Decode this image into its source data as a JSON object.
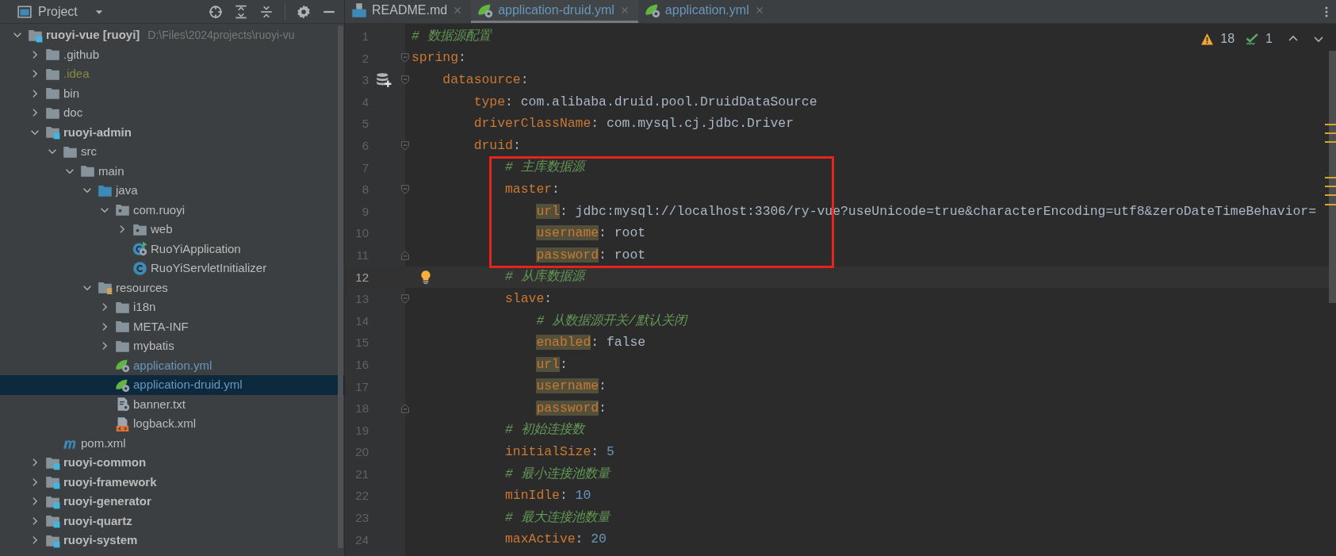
{
  "project_panel": {
    "title": "Project",
    "tree": [
      {
        "label": "ruoyi-vue [ruoyi]",
        "location": "D:\\Files\\2024projects\\ruoyi-vu",
        "kind": "module",
        "expanded": true,
        "selected": false,
        "ignored": false,
        "modified": false,
        "children": [
          {
            "label": ".github",
            "kind": "folder",
            "expanded": false,
            "selected": false,
            "ignored": false,
            "modified": false
          },
          {
            "label": ".idea",
            "kind": "folder",
            "expanded": false,
            "selected": false,
            "ignored": true,
            "modified": false
          },
          {
            "label": "bin",
            "kind": "folder",
            "expanded": false,
            "selected": false,
            "ignored": false,
            "modified": false
          },
          {
            "label": "doc",
            "kind": "folder",
            "expanded": false,
            "selected": false,
            "ignored": false,
            "modified": false
          },
          {
            "label": "ruoyi-admin",
            "kind": "module",
            "expanded": true,
            "selected": false,
            "ignored": false,
            "modified": false,
            "children": [
              {
                "label": "src",
                "kind": "folder",
                "expanded": true,
                "selected": false,
                "ignored": false,
                "modified": false,
                "children": [
                  {
                    "label": "main",
                    "kind": "folder",
                    "expanded": true,
                    "selected": false,
                    "ignored": false,
                    "modified": false,
                    "children": [
                      {
                        "label": "java",
                        "kind": "source-root",
                        "expanded": true,
                        "selected": false,
                        "ignored": false,
                        "modified": false,
                        "children": [
                          {
                            "label": "com.ruoyi",
                            "kind": "package",
                            "expanded": true,
                            "selected": false,
                            "ignored": false,
                            "modified": false,
                            "children": [
                              {
                                "label": "web",
                                "kind": "package",
                                "expanded": false,
                                "selected": false,
                                "ignored": false,
                                "modified": false
                              },
                              {
                                "label": "RuoYiApplication",
                                "kind": "class-run",
                                "selected": false,
                                "ignored": false,
                                "modified": false
                              },
                              {
                                "label": "RuoYiServletInitializer",
                                "kind": "class",
                                "selected": false,
                                "ignored": false,
                                "modified": false
                              }
                            ]
                          }
                        ]
                      },
                      {
                        "label": "resources",
                        "kind": "resources-root",
                        "expanded": true,
                        "selected": false,
                        "ignored": false,
                        "modified": false,
                        "children": [
                          {
                            "label": "i18n",
                            "kind": "folder",
                            "expanded": false,
                            "selected": false,
                            "ignored": false,
                            "modified": false
                          },
                          {
                            "label": "META-INF",
                            "kind": "folder",
                            "expanded": false,
                            "selected": false,
                            "ignored": false,
                            "modified": false
                          },
                          {
                            "label": "mybatis",
                            "kind": "folder",
                            "expanded": false,
                            "selected": false,
                            "ignored": false,
                            "modified": false
                          },
                          {
                            "label": "application.yml",
                            "kind": "spring-config",
                            "selected": false,
                            "ignored": false,
                            "modified": true
                          },
                          {
                            "label": "application-druid.yml",
                            "kind": "spring-config",
                            "selected": true,
                            "ignored": false,
                            "modified": true
                          },
                          {
                            "label": "banner.txt",
                            "kind": "text",
                            "selected": false,
                            "ignored": false,
                            "modified": false
                          },
                          {
                            "label": "logback.xml",
                            "kind": "xml",
                            "selected": false,
                            "ignored": false,
                            "modified": false
                          }
                        ]
                      }
                    ]
                  }
                ]
              },
              {
                "label": "pom.xml",
                "kind": "maven",
                "selected": false,
                "ignored": false,
                "modified": false
              }
            ]
          },
          {
            "label": "ruoyi-common",
            "kind": "module",
            "expanded": false,
            "selected": false,
            "ignored": false,
            "modified": false
          },
          {
            "label": "ruoyi-framework",
            "kind": "module",
            "expanded": false,
            "selected": false,
            "ignored": false,
            "modified": false
          },
          {
            "label": "ruoyi-generator",
            "kind": "module",
            "expanded": false,
            "selected": false,
            "ignored": false,
            "modified": false
          },
          {
            "label": "ruoyi-quartz",
            "kind": "module",
            "expanded": false,
            "selected": false,
            "ignored": false,
            "modified": false
          },
          {
            "label": "ruoyi-system",
            "kind": "module",
            "expanded": false,
            "selected": false,
            "ignored": false,
            "modified": false
          }
        ]
      }
    ]
  },
  "editor": {
    "tabs": [
      {
        "label": "README.md",
        "kind": "markdown",
        "selected": false,
        "modified": false
      },
      {
        "label": "application-druid.yml",
        "kind": "spring-config",
        "selected": true,
        "modified": true
      },
      {
        "label": "application.yml",
        "kind": "spring-config",
        "selected": false,
        "modified": true
      }
    ],
    "inspections": {
      "warnings": "18",
      "passed": "1"
    },
    "lines": [
      {
        "number": "1",
        "kind": "comment",
        "text": "# 数据源配置",
        "current": false,
        "boxed": false,
        "fold_end": false
      },
      {
        "number": "2",
        "kind": "pair",
        "key": "spring",
        "sep": ":",
        "highlighted": false,
        "current": false,
        "boxed": false,
        "fold_end": false,
        "children": [
          {
            "number": "3",
            "kind": "pair",
            "key": "datasource",
            "sep": ":",
            "highlighted": false,
            "current": false,
            "boxed": false,
            "fold_end": false,
            "gutter_icon": {
              "kind": "database"
            },
            "children": [
              {
                "number": "4",
                "kind": "pair",
                "key": "type",
                "sep": ":",
                "value": {
                  "text": "com.alibaba.druid.pool.DruidDataSource",
                  "kind": "string"
                },
                "highlighted": false,
                "current": false,
                "boxed": false,
                "fold_end": false
              },
              {
                "number": "5",
                "kind": "pair",
                "key": "driverClassName",
                "sep": ":",
                "value": {
                  "text": "com.mysql.cj.jdbc.Driver",
                  "kind": "string"
                },
                "highlighted": false,
                "current": false,
                "boxed": false,
                "fold_end": false
              },
              {
                "number": "6",
                "kind": "pair",
                "key": "druid",
                "sep": ":",
                "highlighted": false,
                "current": false,
                "boxed": false,
                "fold_end": false,
                "children": [
                  {
                    "number": "7",
                    "kind": "comment",
                    "text": "# 主库数据源",
                    "current": false,
                    "boxed": true,
                    "fold_end": false
                  },
                  {
                    "number": "8",
                    "kind": "pair",
                    "key": "master",
                    "sep": ":",
                    "highlighted": false,
                    "current": false,
                    "boxed": true,
                    "fold_end": false,
                    "children": [
                      {
                        "number": "9",
                        "kind": "pair",
                        "key": "url",
                        "sep": ":",
                        "value": {
                          "text": "jdbc:mysql://localhost:3306/ry-vue?useUnicode=true&characterEncoding=utf8&zeroDateTimeBehavior=",
                          "kind": "string"
                        },
                        "highlighted": true,
                        "current": false,
                        "boxed": true,
                        "fold_end": false
                      },
                      {
                        "number": "10",
                        "kind": "pair",
                        "key": "username",
                        "sep": ":",
                        "value": {
                          "text": "root",
                          "kind": "string"
                        },
                        "highlighted": true,
                        "current": false,
                        "boxed": true,
                        "fold_end": false
                      },
                      {
                        "number": "11",
                        "kind": "pair",
                        "key": "password",
                        "sep": ":",
                        "value": {
                          "text": "root",
                          "kind": "string"
                        },
                        "highlighted": true,
                        "current": false,
                        "boxed": true,
                        "fold_end": true
                      }
                    ]
                  },
                  {
                    "number": "12",
                    "kind": "comment",
                    "text": "# 从库数据源",
                    "current": true,
                    "boxed": false,
                    "fold_end": false,
                    "gutter_icon": {
                      "kind": "bulb"
                    }
                  },
                  {
                    "number": "13",
                    "kind": "pair",
                    "key": "slave",
                    "sep": ":",
                    "highlighted": false,
                    "current": false,
                    "boxed": false,
                    "fold_end": false,
                    "children": [
                      {
                        "number": "14",
                        "kind": "comment",
                        "text": "# 从数据源开关/默认关闭",
                        "current": false,
                        "boxed": false,
                        "fold_end": false
                      },
                      {
                        "number": "15",
                        "kind": "pair",
                        "key": "enabled",
                        "sep": ":",
                        "value": {
                          "text": "false",
                          "kind": "string"
                        },
                        "highlighted": true,
                        "current": false,
                        "boxed": false,
                        "fold_end": false
                      },
                      {
                        "number": "16",
                        "kind": "pair",
                        "key": "url",
                        "sep": ":",
                        "highlighted": true,
                        "current": false,
                        "boxed": false,
                        "fold_end": false
                      },
                      {
                        "number": "17",
                        "kind": "pair",
                        "key": "username",
                        "sep": ":",
                        "highlighted": true,
                        "current": false,
                        "boxed": false,
                        "fold_end": false
                      },
                      {
                        "number": "18",
                        "kind": "pair",
                        "key": "password",
                        "sep": ":",
                        "highlighted": true,
                        "current": false,
                        "boxed": false,
                        "fold_end": true
                      }
                    ]
                  },
                  {
                    "number": "19",
                    "kind": "comment",
                    "text": "# 初始连接数",
                    "current": false,
                    "boxed": false,
                    "fold_end": false
                  },
                  {
                    "number": "20",
                    "kind": "pair",
                    "key": "initialSize",
                    "sep": ":",
                    "value": {
                      "text": "5",
                      "kind": "number"
                    },
                    "highlighted": false,
                    "current": false,
                    "boxed": false,
                    "fold_end": false
                  },
                  {
                    "number": "21",
                    "kind": "comment",
                    "text": "# 最小连接池数量",
                    "current": false,
                    "boxed": false,
                    "fold_end": false
                  },
                  {
                    "number": "22",
                    "kind": "pair",
                    "key": "minIdle",
                    "sep": ":",
                    "value": {
                      "text": "10",
                      "kind": "number"
                    },
                    "highlighted": false,
                    "current": false,
                    "boxed": false,
                    "fold_end": false
                  },
                  {
                    "number": "23",
                    "kind": "comment",
                    "text": "# 最大连接池数量",
                    "current": false,
                    "boxed": false,
                    "fold_end": false
                  },
                  {
                    "number": "24",
                    "kind": "pair",
                    "key": "maxActive",
                    "sep": ":",
                    "value": {
                      "text": "20",
                      "kind": "number"
                    },
                    "highlighted": false,
                    "current": false,
                    "boxed": false,
                    "fold_end": false
                  }
                ]
              }
            ]
          }
        ]
      }
    ]
  }
}
